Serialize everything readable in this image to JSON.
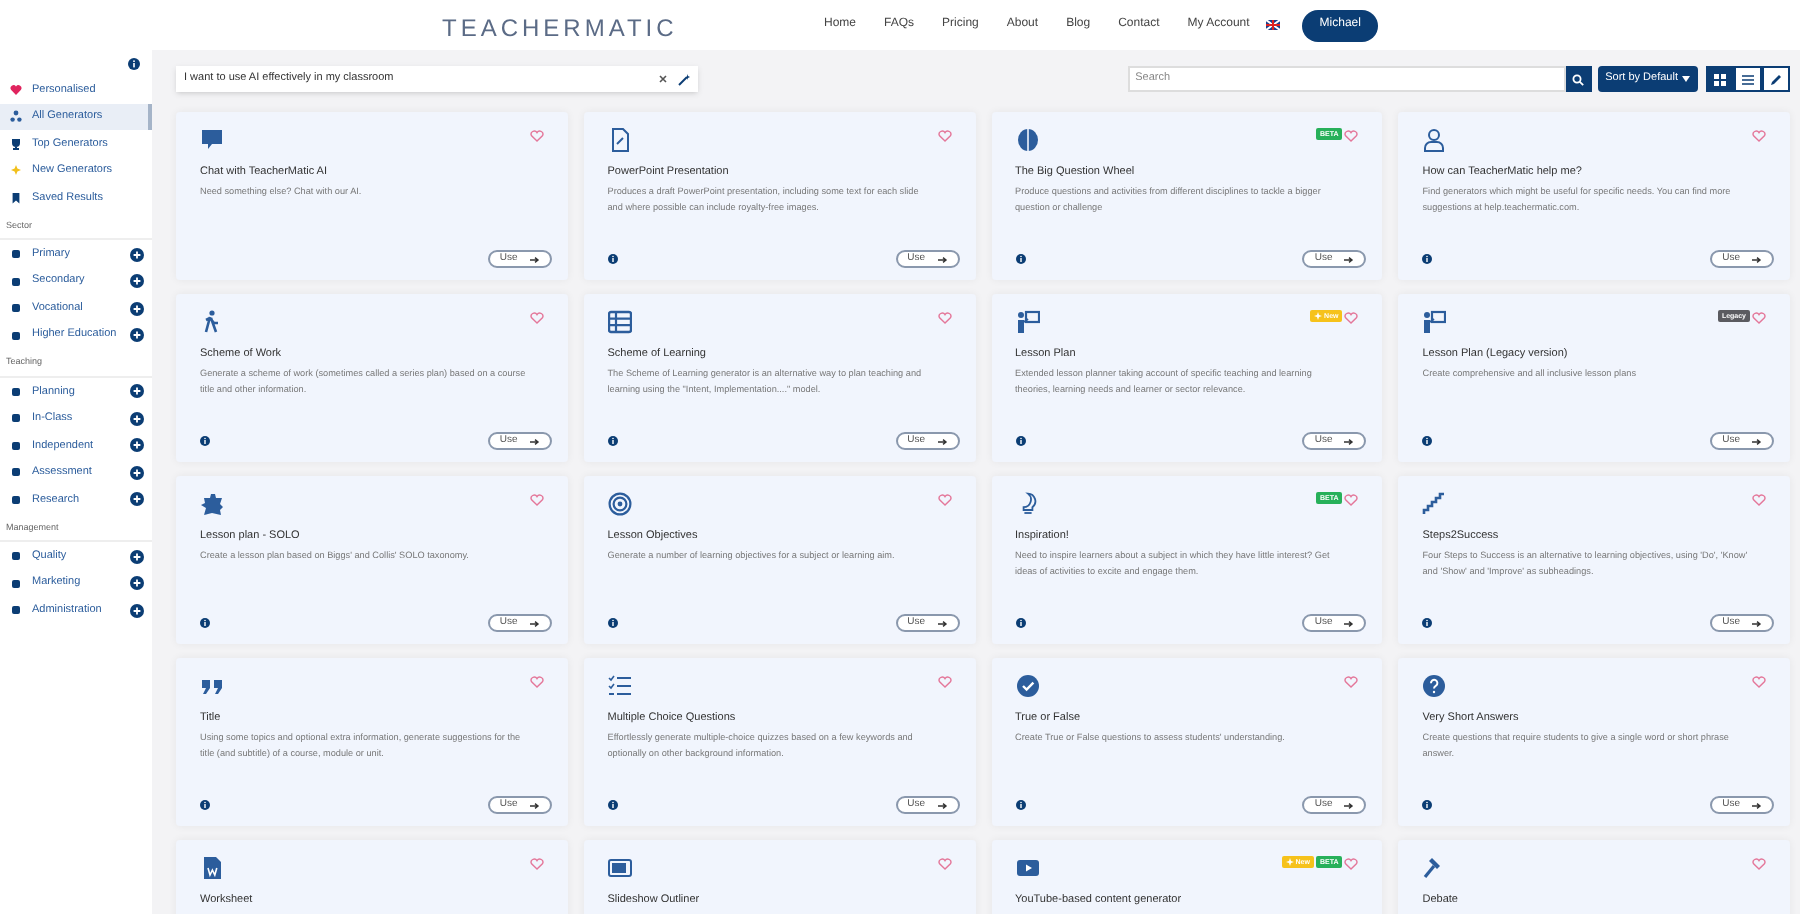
{
  "header": {
    "logo": "TEACHERMATIC",
    "nav": [
      "Home",
      "FAQs",
      "Pricing",
      "About",
      "Blog",
      "Contact",
      "My Account"
    ],
    "user": "Michael"
  },
  "sidebar": {
    "top_items": [
      {
        "label": "Personalised",
        "selected": false
      },
      {
        "label": "All Generators",
        "selected": true
      },
      {
        "label": "Top Generators",
        "selected": false
      },
      {
        "label": "New Generators",
        "selected": false
      },
      {
        "label": "Saved Results",
        "selected": false
      }
    ],
    "sections": [
      {
        "heading": "Sector",
        "items": [
          "Primary",
          "Secondary",
          "Vocational",
          "Higher Education"
        ]
      },
      {
        "heading": "Teaching",
        "items": [
          "Planning",
          "In-Class",
          "Independent",
          "Assessment",
          "Research"
        ]
      },
      {
        "heading": "Management",
        "items": [
          "Quality",
          "Marketing",
          "Administration"
        ]
      }
    ]
  },
  "toolbar": {
    "prompt": "I want to use AI effectively in my classroom",
    "search_placeholder": "Search",
    "sort": "Sort by Default",
    "views": [
      {
        "kind": "grid",
        "selected": true
      },
      {
        "kind": "list",
        "selected": false
      },
      {
        "kind": "edit",
        "selected": false
      }
    ]
  },
  "cards": [
    {
      "title": "Chat with TeacherMatic AI",
      "description": "Need something else? Chat with our AI.",
      "info": false,
      "button": "Use"
    },
    {
      "title": "PowerPoint Presentation",
      "description": "Produces a draft PowerPoint presentation, including some text for each slide and where possible can include royalty-free images.",
      "info": true,
      "button": "Use"
    },
    {
      "title": "The Big Question Wheel",
      "description": "Produce questions and activities from different disciplines to tackle a bigger question or challenge",
      "badges": [
        {
          "kind": "beta",
          "label": "BETA"
        }
      ],
      "info": true,
      "button": "Use"
    },
    {
      "title": "How can TeacherMatic help me?",
      "description": "Find generators which might be useful for specific needs. You can find more suggestions at help.teachermatic.com.",
      "info": true,
      "button": "Use"
    },
    {
      "title": "Scheme of Work",
      "description": "Generate a scheme of work (sometimes called a series plan) based on a course title and other information.",
      "info": true,
      "button": "Use"
    },
    {
      "title": "Scheme of Learning",
      "description": "The Scheme of Learning generator is an alternative way to plan teaching and learning using the \"Intent, Implementation....\" model.",
      "info": true,
      "button": "Use"
    },
    {
      "title": "Lesson Plan",
      "description": "Extended lesson planner taking account of specific teaching and learning theories, learning needs and learner or sector relevance.",
      "badges": [
        {
          "kind": "new",
          "label": "New"
        }
      ],
      "info": true,
      "button": "Use"
    },
    {
      "title": "Lesson Plan (Legacy version)",
      "description": "Create comprehensive and all inclusive lesson plans",
      "badges": [
        {
          "kind": "legacy",
          "label": "Legacy"
        }
      ],
      "info": true,
      "button": "Use"
    },
    {
      "title": "Lesson plan - SOLO",
      "description": "Create a lesson plan based on Biggs' and Collis' SOLO taxonomy.",
      "info": true,
      "button": "Use"
    },
    {
      "title": "Lesson Objectives",
      "description": "Generate a number of learning objectives for a subject or learning aim.",
      "info": true,
      "button": "Use"
    },
    {
      "title": "Inspiration!",
      "description": "Need to inspire learners about a subject in which they have little interest? Get ideas of activities to excite and engage them.",
      "badges": [
        {
          "kind": "beta",
          "label": "BETA"
        }
      ],
      "info": true,
      "button": "Use"
    },
    {
      "title": "Steps2Success",
      "description": "Four Steps to Success is an alternative to learning objectives, using 'Do', 'Know' and 'Show' and 'Improve' as subheadings.",
      "info": true,
      "button": "Use"
    },
    {
      "title": "Title",
      "description": "Using some topics and optional extra information, generate suggestions for the title (and subtitle) of a course, module or unit.",
      "info": true,
      "button": "Use"
    },
    {
      "title": "Multiple Choice Questions",
      "description": "Effortlessly generate multiple-choice quizzes based on a few keywords and optionally on other background information.",
      "info": true,
      "button": "Use"
    },
    {
      "title": "True or False",
      "description": "Create True or False questions to assess students' understanding.",
      "info": true,
      "button": "Use"
    },
    {
      "title": "Very Short Answers",
      "description": "Create questions that require students to give a single word or short phrase answer.",
      "info": true,
      "button": "Use"
    },
    {
      "title": "Worksheet"
    },
    {
      "title": "Slideshow Outliner"
    },
    {
      "title": "YouTube-based content generator",
      "badges": [
        {
          "kind": "new",
          "label": "New"
        },
        {
          "kind": "beta",
          "label": "BETA"
        }
      ]
    },
    {
      "title": "Debate"
    }
  ]
}
